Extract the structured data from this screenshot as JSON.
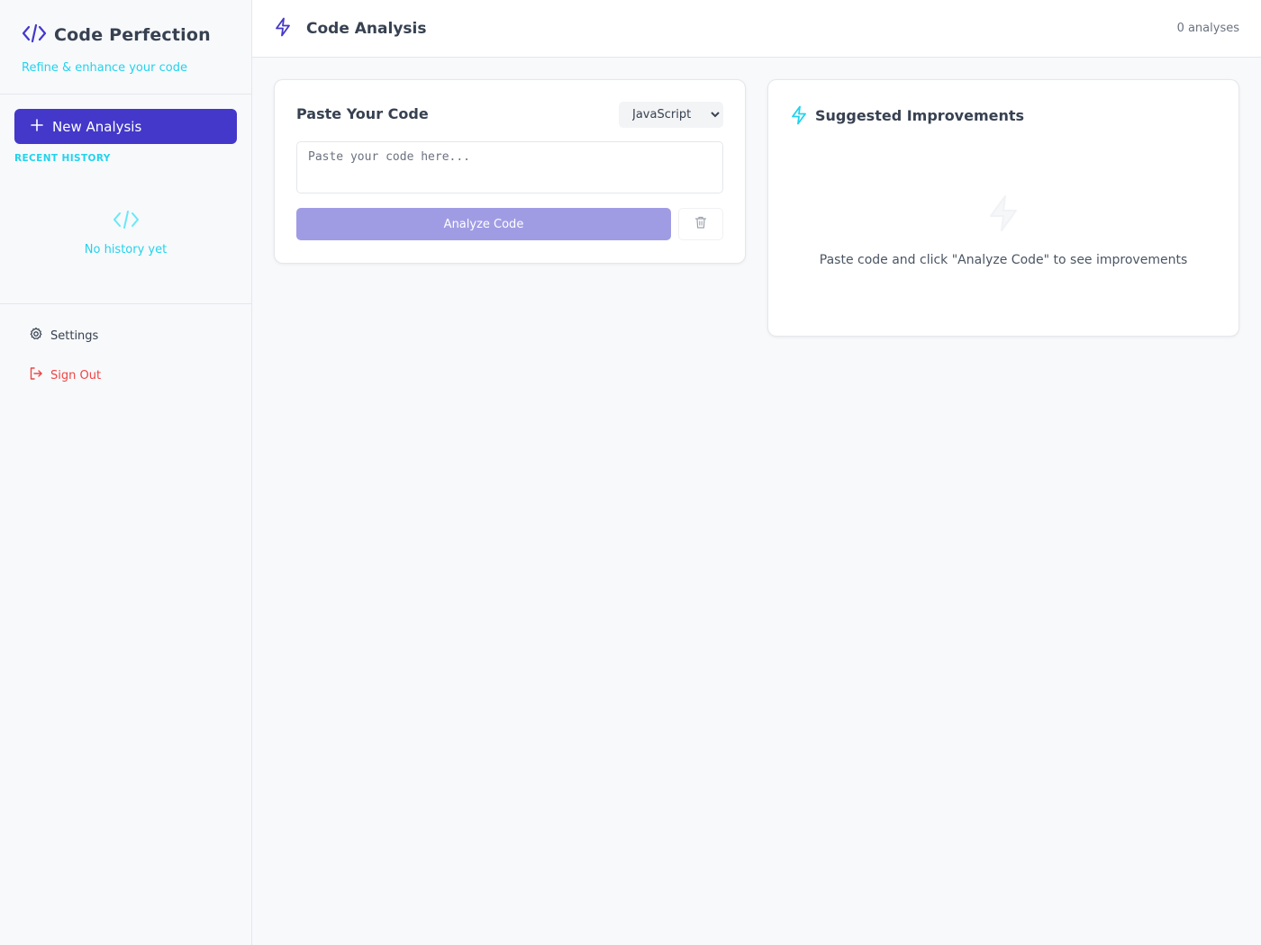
{
  "sidebar": {
    "brand_title": "Code Perfection",
    "brand_subtitle": "Refine & enhance your code",
    "new_analysis_label": "New Analysis",
    "recent_history_label": "RECENT HISTORY",
    "empty_history_text": "No history yet",
    "settings_label": "Settings",
    "sign_out_label": "Sign Out"
  },
  "header": {
    "title": "Code Analysis",
    "analyses_count": "0 analyses"
  },
  "input_panel": {
    "title": "Paste Your Code",
    "language_selected": "JavaScript",
    "code_placeholder": "Paste your code here...",
    "analyze_label": "Analyze Code"
  },
  "results_panel": {
    "title": "Suggested Improvements",
    "empty_text": "Paste code and click \"Analyze Code\" to see improvements"
  },
  "icons": {
    "brand": "code-icon",
    "new": "plus-icon",
    "history_empty": "code-icon",
    "settings": "gear-icon",
    "sign_out": "sign-out-icon",
    "header": "lightning-icon",
    "results": "lightning-icon",
    "clear": "trash-icon"
  },
  "colors": {
    "primary": "#4338ca",
    "accent": "#22d3ee",
    "danger": "#ef4444",
    "button_disabled": "#a09ce4"
  }
}
